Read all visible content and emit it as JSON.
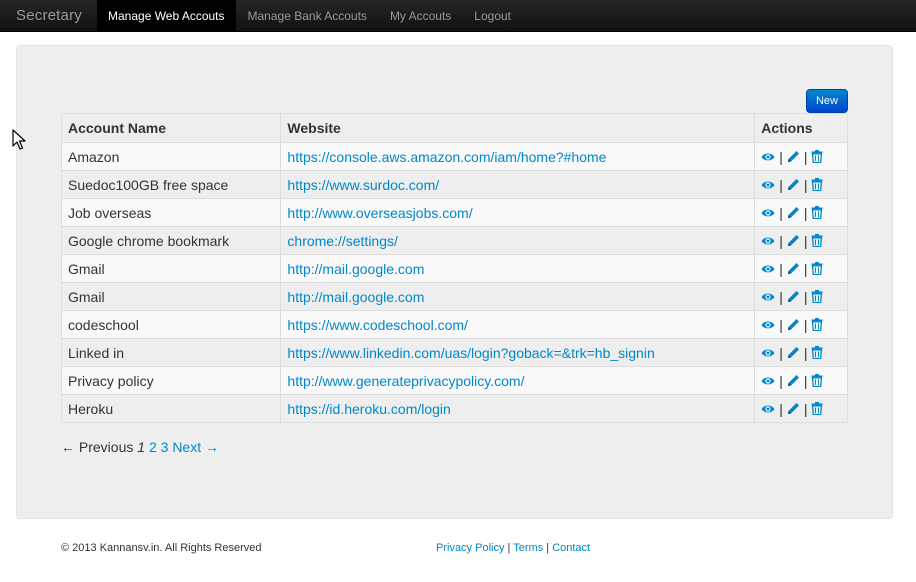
{
  "navbar": {
    "brand": "Secretary",
    "items": [
      {
        "label": "Manage Web Accouts",
        "active": true
      },
      {
        "label": "Manage Bank Accouts",
        "active": false
      },
      {
        "label": "My Accouts",
        "active": false
      },
      {
        "label": "Logout",
        "active": false
      }
    ]
  },
  "new_button": "New",
  "table": {
    "headers": [
      "Account Name",
      "Website",
      "Actions"
    ],
    "rows": [
      {
        "name": "Amazon",
        "website": "https://console.aws.amazon.com/iam/home?#home"
      },
      {
        "name": "Suedoc100GB free space",
        "website": "https://www.surdoc.com/"
      },
      {
        "name": "Job overseas",
        "website": "http://www.overseasjobs.com/"
      },
      {
        "name": "Google chrome bookmark",
        "website": "chrome://settings/"
      },
      {
        "name": "Gmail",
        "website": "http://mail.google.com"
      },
      {
        "name": "Gmail",
        "website": "http://mail.google.com"
      },
      {
        "name": "codeschool",
        "website": "https://www.codeschool.com/"
      },
      {
        "name": "Linked in",
        "website": "https://www.linkedin.com/uas/login?goback=&trk=hb_signin"
      },
      {
        "name": "Privacy policy",
        "website": "http://www.generateprivacypolicy.com/"
      },
      {
        "name": "Heroku",
        "website": "https://id.heroku.com/login"
      }
    ],
    "action_icons": [
      "eye-icon",
      "pencil-icon",
      "trash-icon"
    ],
    "action_separator": "|"
  },
  "pagination": {
    "previous": "← Previous",
    "current": "1",
    "pages": [
      "2",
      "3"
    ],
    "next": "Next →"
  },
  "footer": {
    "copyright": "© 2013 Kannansv.in. All Rights Reserved",
    "links": [
      "Privacy Policy",
      "Terms",
      "Contact"
    ],
    "separator": "|"
  },
  "colors": {
    "link": "#0088cc",
    "navbar": "#1b1b1b",
    "button": "#0066cc"
  }
}
